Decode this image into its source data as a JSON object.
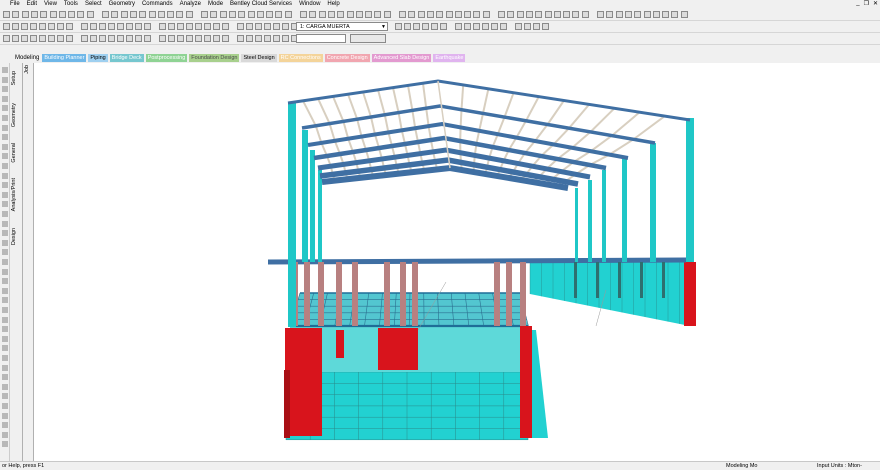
{
  "menu": [
    "File",
    "Edit",
    "View",
    "Tools",
    "Select",
    "Geometry",
    "Commands",
    "Analyze",
    "Mode",
    "Bentley Cloud Services",
    "Window",
    "Help"
  ],
  "load_case": "1: CARGA MUERTA",
  "page_control": {
    "label": "Modeling",
    "tabs": [
      {
        "label": "Building Planner",
        "bg": "#6fb7e8",
        "fg": "#ffffff"
      },
      {
        "label": "Piping",
        "bg": "#9fd0f0",
        "fg": "#000000"
      },
      {
        "label": "Bridge Deck",
        "bg": "#76c7cf",
        "fg": "#ffffff"
      },
      {
        "label": "Postprocessing",
        "bg": "#8fd394",
        "fg": "#ffffff"
      },
      {
        "label": "Foundation Design",
        "bg": "#a8d08d",
        "fg": "#4a4a4a"
      },
      {
        "label": "Steel Design",
        "bg": "#d9d9d9",
        "fg": "#000000"
      },
      {
        "label": "RC Connections",
        "bg": "#f4d49a",
        "fg": "#ffffff"
      },
      {
        "label": "Concrete Design",
        "bg": "#f1a6b0",
        "fg": "#ffffff"
      },
      {
        "label": "Advanced Slab Design",
        "bg": "#e39ad0",
        "fg": "#ffffff"
      },
      {
        "label": "Earthquake",
        "bg": "#e0b4ef",
        "fg": "#ffffff"
      }
    ]
  },
  "side_tabs": [
    "Setup",
    "Geometry",
    "General",
    "Analysis/Print",
    "Design"
  ],
  "job_tab": "Job",
  "status": {
    "help": "or Help, press F1",
    "mode": "Modeling Mo",
    "units": "Input Units : Mton-"
  },
  "colors": {
    "beam_blue": "#3f6fa3",
    "purlin": "#d8cfc0",
    "column_cyan": "#1fc7c7",
    "wall_cyan": "#22d1d1",
    "concrete_red": "#d8141c",
    "column_brown": "#b88080",
    "grid_line": "#2a8b8b"
  }
}
